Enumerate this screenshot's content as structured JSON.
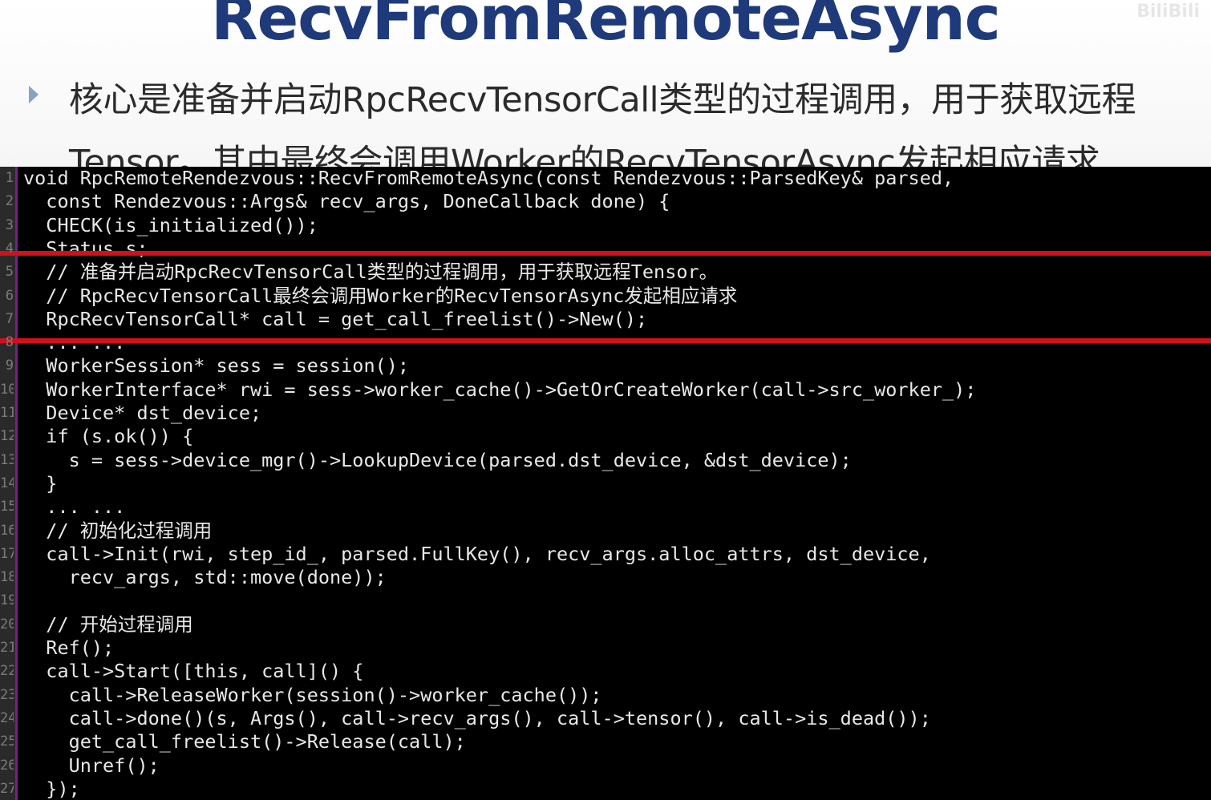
{
  "slide": {
    "title": "RecvFromRemoteAsync",
    "bullet_line1": "核心是准备并启动RpcRecvTensorCall类型的过程调用，用于获取远程",
    "bullet_line2": "Tensor。其中最终会调用Worker的RecvTensorAsync发起相应请求",
    "watermark": "BiliBili"
  },
  "code": {
    "lines": [
      {
        "no": "1",
        "text": "void RpcRemoteRendezvous::RecvFromRemoteAsync(const Rendezvous::ParsedKey& parsed,"
      },
      {
        "no": "2",
        "text": "  const Rendezvous::Args& recv_args, DoneCallback done) {"
      },
      {
        "no": "3",
        "text": "  CHECK(is_initialized());"
      },
      {
        "no": "4",
        "text": "  Status s;"
      },
      {
        "no": "5",
        "text": "  // 准备并启动RpcRecvTensorCall类型的过程调用，用于获取远程Tensor。"
      },
      {
        "no": "6",
        "text": "  // RpcRecvTensorCall最终会调用Worker的RecvTensorAsync发起相应请求"
      },
      {
        "no": "7",
        "text": "  RpcRecvTensorCall* call = get_call_freelist()->New();"
      },
      {
        "no": "8",
        "text": "  ... ..."
      },
      {
        "no": "9",
        "text": "  WorkerSession* sess = session();"
      },
      {
        "no": "10",
        "text": "  WorkerInterface* rwi = sess->worker_cache()->GetOrCreateWorker(call->src_worker_);"
      },
      {
        "no": "11",
        "text": "  Device* dst_device;"
      },
      {
        "no": "12",
        "text": "  if (s.ok()) {"
      },
      {
        "no": "13",
        "text": "    s = sess->device_mgr()->LookupDevice(parsed.dst_device, &dst_device);"
      },
      {
        "no": "14",
        "text": "  }"
      },
      {
        "no": "15",
        "text": "  ... ..."
      },
      {
        "no": "16",
        "text": "  // 初始化过程调用"
      },
      {
        "no": "17",
        "text": "  call->Init(rwi, step_id_, parsed.FullKey(), recv_args.alloc_attrs, dst_device,"
      },
      {
        "no": "18",
        "text": "    recv_args, std::move(done));"
      },
      {
        "no": "19",
        "text": ""
      },
      {
        "no": "20",
        "text": "  // 开始过程调用"
      },
      {
        "no": "21",
        "text": "  Ref();"
      },
      {
        "no": "22",
        "text": "  call->Start([this, call]() {"
      },
      {
        "no": "23",
        "text": "    call->ReleaseWorker(session()->worker_cache());"
      },
      {
        "no": "24",
        "text": "    call->done()(s, Args(), call->recv_args(), call->tensor(), call->is_dead());"
      },
      {
        "no": "25",
        "text": "    get_call_freelist()->Release(call);"
      },
      {
        "no": "26",
        "text": "    Unref();"
      },
      {
        "no": "27",
        "text": "  });"
      }
    ],
    "highlighted_lines": [
      "5",
      "6",
      "7"
    ],
    "colors": {
      "background": "#000000",
      "text": "#e8e8e8",
      "gutter": "#2a2a2a",
      "gutter_border": "#7a1f8e",
      "highlight_border": "#d0101a"
    }
  },
  "colors": {
    "title": "#1f3a7a",
    "bullet_text": "#2b2b2b",
    "bullet_icon": "#8aa0c6"
  }
}
